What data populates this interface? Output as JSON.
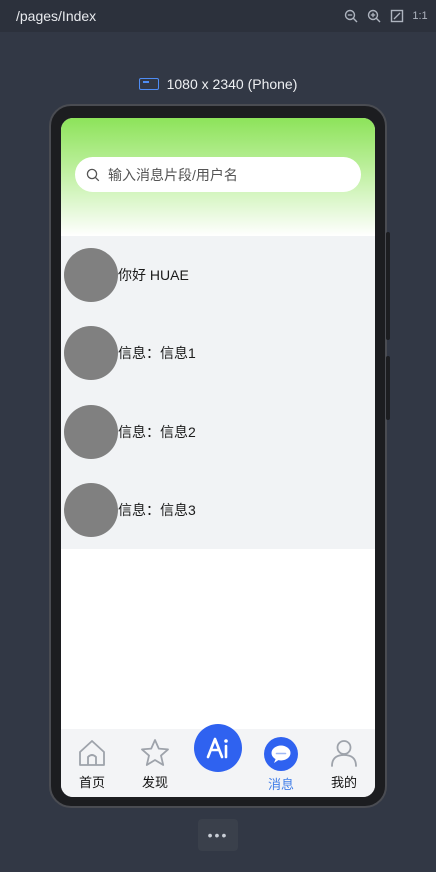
{
  "window": {
    "path": "/pages/Index"
  },
  "toolbar_icons": [
    "zoom-out-icon",
    "zoom-in-icon",
    "fit-screen-icon",
    "actual-size-icon"
  ],
  "actual_size_label": "1:1",
  "device": {
    "label": "1080 x 2340 (Phone)"
  },
  "search": {
    "placeholder": "输入消息片段/用户名"
  },
  "messages": [
    {
      "text": "你好 HUAE"
    },
    {
      "text": "信息：信息1"
    },
    {
      "text": "信息：信息2"
    },
    {
      "text": "信息：信息3"
    }
  ],
  "tabs": [
    {
      "label": "首页",
      "icon": "home-icon"
    },
    {
      "label": "发现",
      "icon": "star-icon"
    },
    {
      "label": "",
      "icon": "ai-icon"
    },
    {
      "label": "消息",
      "icon": "message-icon",
      "active": true
    },
    {
      "label": "我的",
      "icon": "user-icon"
    }
  ],
  "more": {
    "label": "•••"
  },
  "colors": {
    "accent": "#2f62f0",
    "active_tab": "#3f7de8",
    "hero_green": "#8de35a"
  }
}
